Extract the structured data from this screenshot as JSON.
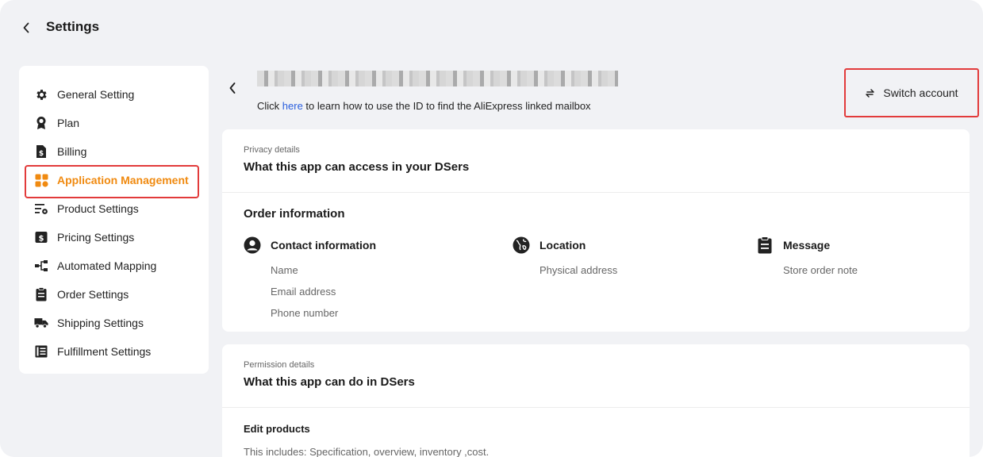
{
  "header": {
    "title": "Settings"
  },
  "sidebar": {
    "items": [
      {
        "label": "General Setting",
        "icon": "gear-icon"
      },
      {
        "label": "Plan",
        "icon": "award-icon"
      },
      {
        "label": "Billing",
        "icon": "invoice-icon"
      },
      {
        "label": "Application Management",
        "icon": "apps-grid-icon",
        "active": true
      },
      {
        "label": "Product Settings",
        "icon": "list-gear-icon"
      },
      {
        "label": "Pricing Settings",
        "icon": "dollar-box-icon"
      },
      {
        "label": "Automated Mapping",
        "icon": "mapping-icon"
      },
      {
        "label": "Order Settings",
        "icon": "clipboard-icon"
      },
      {
        "label": "Shipping Settings",
        "icon": "truck-icon"
      },
      {
        "label": "Fulfillment Settings",
        "icon": "document-list-icon"
      }
    ]
  },
  "main": {
    "hint_prefix": "Click ",
    "hint_link": "here",
    "hint_suffix": " to learn how to use the ID to find the AliExpress linked mailbox",
    "switch_account": "Switch account"
  },
  "privacy": {
    "eyebrow": "Privacy details",
    "heading": "What this app can access in your DSers",
    "order_title": "Order information",
    "columns": [
      {
        "title": "Contact information",
        "icon": "user-circle-icon",
        "items": [
          "Name",
          "Email address",
          "Phone number"
        ]
      },
      {
        "title": "Location",
        "icon": "globe-icon",
        "items": [
          "Physical address"
        ]
      },
      {
        "title": "Message",
        "icon": "clipboard-text-icon",
        "items": [
          "Store order note"
        ]
      }
    ]
  },
  "permission": {
    "eyebrow": "Permission details",
    "heading": "What this app can do in DSers",
    "edit_title": "Edit products",
    "edit_desc": "This includes: Specification, overview, inventory ,cost."
  },
  "colors": {
    "accent": "#f08a10",
    "highlight_border": "#e23b3b",
    "link": "#2b5fde",
    "background": "#f1f2f5"
  }
}
